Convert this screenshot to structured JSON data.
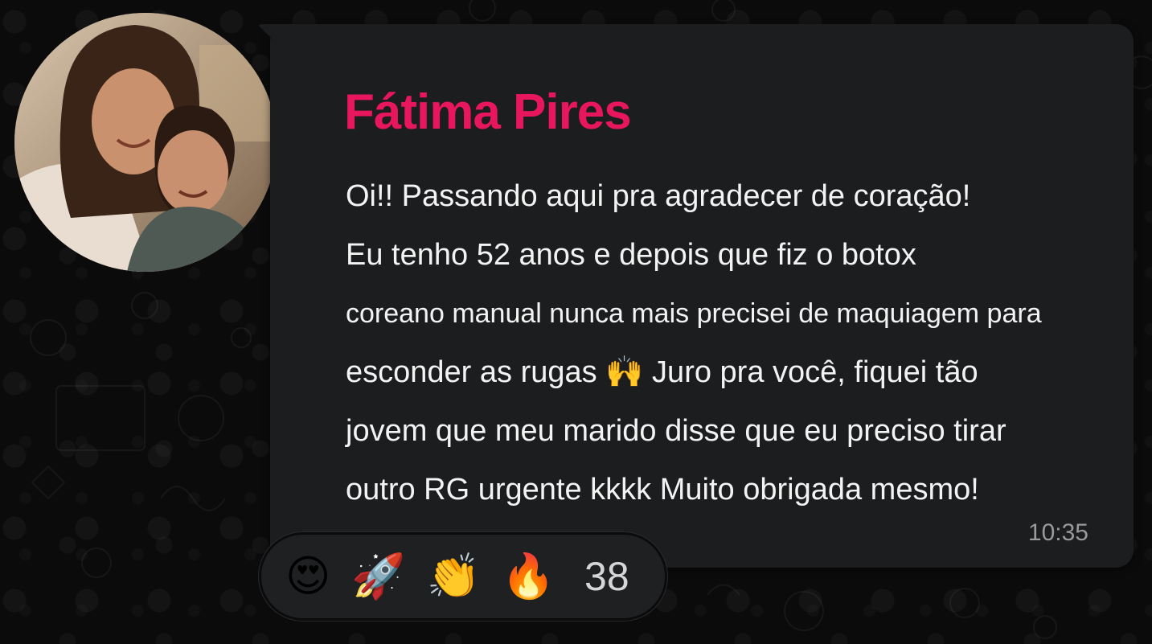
{
  "message": {
    "sender_name": "Fátima Pires",
    "lines": [
      "Oi!! Passando aqui pra agradecer de coração!",
      "Eu tenho 52 anos e depois que fiz o botox",
      "coreano manual nunca mais precisei de maquiagem para",
      "esconder as rugas 🙌 Juro pra você, fiquei tão",
      "jovem que meu marido disse que eu preciso tirar",
      "outro RG urgente kkkk Muito obrigada mesmo!"
    ],
    "time": "10:35"
  },
  "reactions": {
    "emojis": [
      "😍",
      "🚀",
      "👏",
      "🔥"
    ],
    "count": "38"
  },
  "colors": {
    "background": "#0b0b0c",
    "bubble": "#1c1d1f",
    "sender_name": "#e8175d",
    "text": "#f3f3f3",
    "timestamp": "#9a9a9a"
  }
}
